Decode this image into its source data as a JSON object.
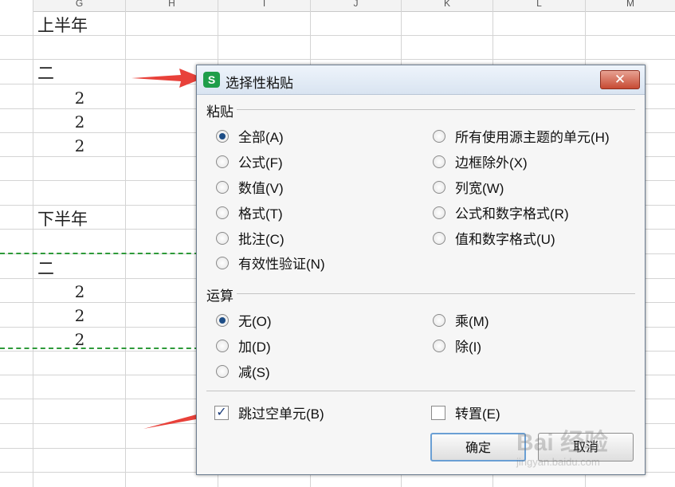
{
  "sheet": {
    "columns": [
      "G",
      "H",
      "I",
      "J",
      "K",
      "L",
      "M"
    ],
    "cells": {
      "first_half": "上半年",
      "second_half": "下半年",
      "er_1": "二",
      "er_2": "二",
      "vals_1": [
        "2",
        "2",
        "2"
      ],
      "vals_2": [
        "2",
        "2",
        "2"
      ]
    }
  },
  "dialog": {
    "app_icon_letter": "S",
    "title": "选择性粘贴",
    "close_symbol": "✕",
    "paste_section": "粘贴",
    "paste_left": [
      "全部(A)",
      "公式(F)",
      "数值(V)",
      "格式(T)",
      "批注(C)",
      "有效性验证(N)"
    ],
    "paste_right": [
      "所有使用源主题的单元(H)",
      "边框除外(X)",
      "列宽(W)",
      "公式和数字格式(R)",
      "值和数字格式(U)"
    ],
    "paste_selected": "全部(A)",
    "op_section": "运算",
    "op_left": [
      "无(O)",
      "加(D)",
      "减(S)"
    ],
    "op_right": [
      "乘(M)",
      "除(I)"
    ],
    "op_selected": "无(O)",
    "skip_blanks_label": "跳过空单元(B)",
    "skip_blanks_checked": true,
    "transpose_label": "转置(E)",
    "transpose_checked": false,
    "ok_label": "确定",
    "cancel_label": "取消"
  },
  "watermark": {
    "logo": "Bai 经验",
    "url": "jingyan.baidu.com"
  },
  "colors": {
    "arrow": "#e8413a",
    "dashed": "#2e9a3a",
    "accent": "#1f9e4a"
  }
}
